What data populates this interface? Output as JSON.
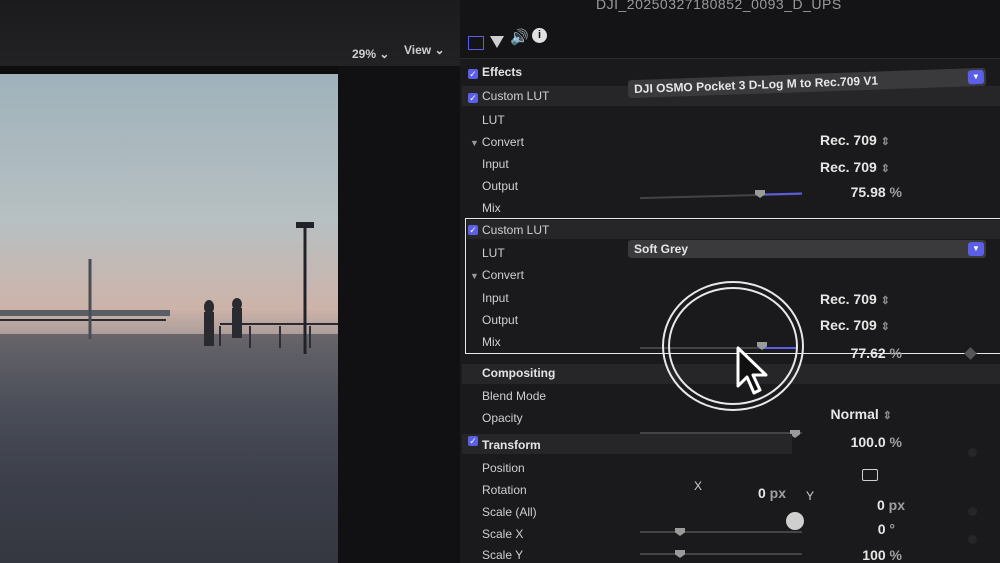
{
  "viewer": {
    "zoom": "29% ⌄",
    "view_menu": "View ⌄"
  },
  "inspector": {
    "clip_name": "DJI_20250327180852_0093_D_UPS",
    "tabs": [
      "video-icon",
      "color-icon",
      "audio-icon",
      "info-icon"
    ],
    "effects_label": "Effects",
    "lut1": {
      "title": "Custom LUT",
      "lut_label": "LUT",
      "lut_value": "DJI OSMO Pocket 3 D-Log M to Rec.709 V1",
      "convert_label": "Convert",
      "input_label": "Input",
      "input_value": "Rec. 709",
      "output_label": "Output",
      "output_value": "Rec. 709",
      "mix_label": "Mix",
      "mix_value": "75.98",
      "mix_unit": "%",
      "mix_level": 0.76
    },
    "lut2": {
      "title": "Custom LUT",
      "lut_label": "LUT",
      "lut_value": "Soft Grey",
      "convert_label": "Convert",
      "input_label": "Input",
      "input_value": "Rec. 709",
      "output_label": "Output",
      "output_value": "Rec. 709",
      "mix_label": "Mix",
      "mix_value": "77.62",
      "mix_unit": "%",
      "mix_level": 0.78
    },
    "compositing": {
      "title": "Compositing",
      "blend_label": "Blend Mode",
      "blend_value": "Normal",
      "opacity_label": "Opacity",
      "opacity_value": "100.0",
      "opacity_unit": "%",
      "opacity_level": 1.0
    },
    "transform": {
      "title": "Transform",
      "position_label": "Position",
      "rotation_label": "Rotation",
      "x_label": "X",
      "x_value": "0",
      "x_unit": "px",
      "y_label": "Y",
      "y_value": "0",
      "y_unit": "px",
      "rotation_value": "0",
      "rotation_unit": "°",
      "scale_all_label": "Scale (All)",
      "scale_all_value": "100",
      "scale_all_unit": "%",
      "scale_x_label": "Scale X",
      "scale_y_label": "Scale Y"
    }
  },
  "colors": {
    "accent": "#5b5ee6",
    "panel": "#1a1a1c"
  }
}
